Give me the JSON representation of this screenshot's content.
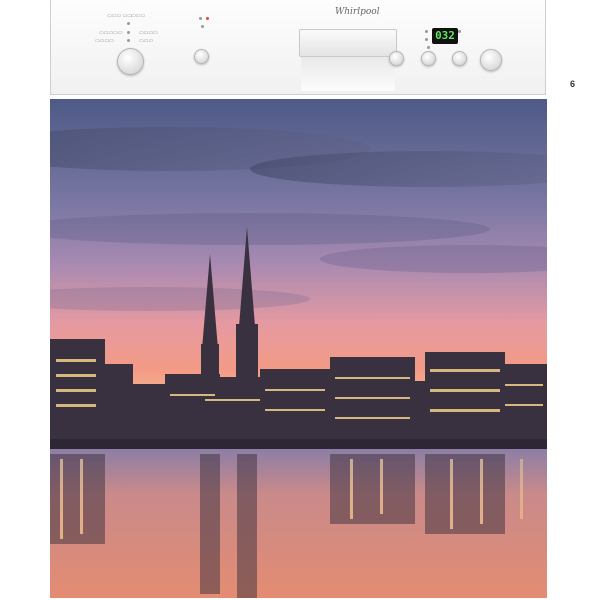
{
  "panel": {
    "brand": "Whirlpool",
    "display_value": "032",
    "sense_badge": "6"
  },
  "colors": {
    "panel": "#f5f5f5",
    "display_bg": "#111111",
    "display_digits": "#5de85d",
    "sky_top": "#4e5a86",
    "sky_mid": "#a88ab2",
    "sky_horizon": "#f39a86",
    "water": "#d9856f"
  }
}
